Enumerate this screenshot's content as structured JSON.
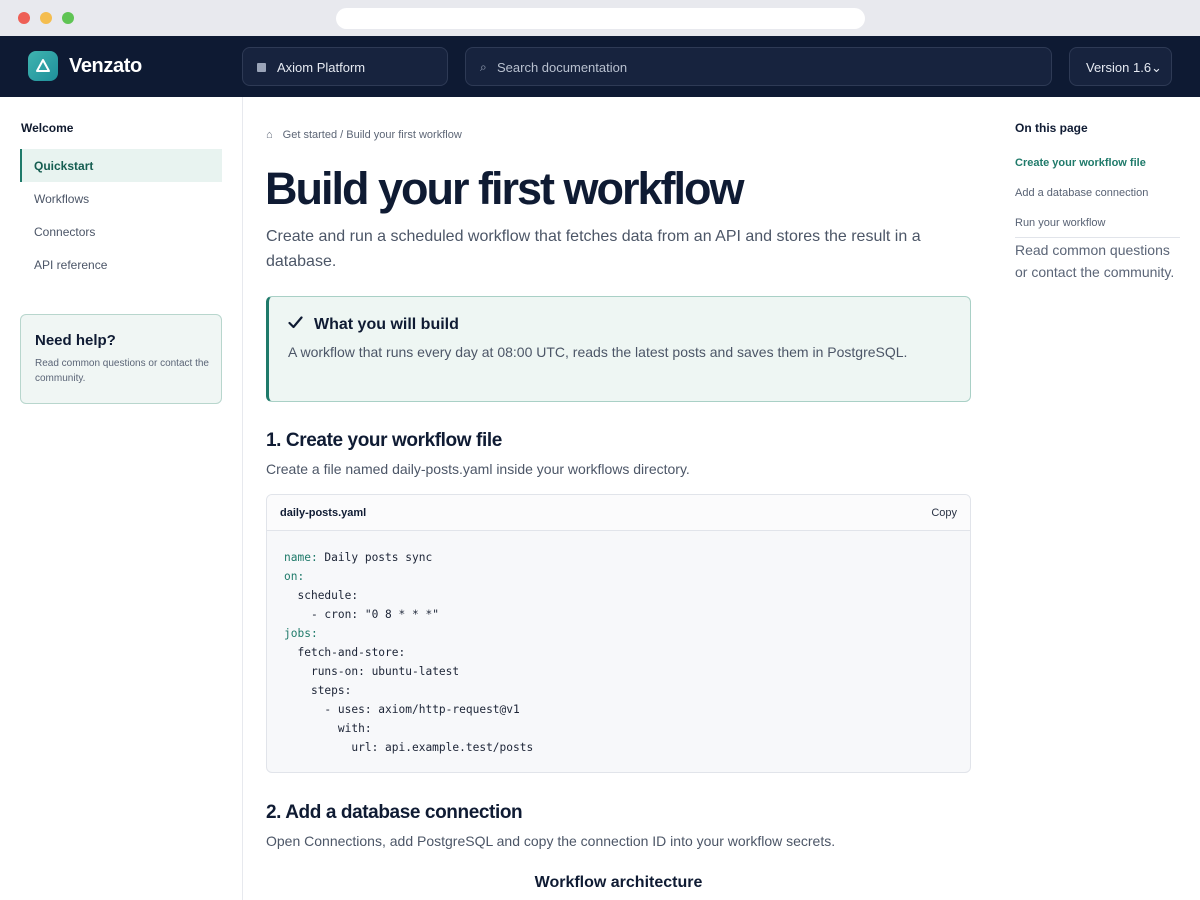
{
  "brand": {
    "name": "Venzato"
  },
  "topnav": {
    "platform": "Axiom Platform",
    "search_placeholder": "Search documentation",
    "version": "Version 1.6",
    "version_chevron": "⌄"
  },
  "sidebar": {
    "heading": "Welcome",
    "items": [
      {
        "label": "Quickstart",
        "active": true
      },
      {
        "label": "Workflows",
        "active": false
      },
      {
        "label": "Connectors",
        "active": false
      },
      {
        "label": "API reference",
        "active": false
      }
    ],
    "help": {
      "title": "Need help?",
      "text": "Read common questions or contact the community."
    }
  },
  "main": {
    "breadcrumb": "Get started / Build your first workflow",
    "title": "Build your first workflow",
    "lead": "Create and run a scheduled workflow that fetches data from an API and stores the result in a database.",
    "callout": {
      "title": "What you will build",
      "text": "A workflow that runs every day at 08:00 UTC, reads the latest posts and saves them in PostgreSQL."
    },
    "section1": {
      "title": "1. Create your workflow file",
      "text": "Create a file named daily-posts.yaml inside your workflows directory."
    },
    "code": {
      "filename": "daily-posts.yaml",
      "copy_label": "Copy",
      "lines": [
        {
          "key": "name:",
          "value": " Daily posts sync",
          "indent": ""
        },
        {
          "key": "on:",
          "value": "",
          "indent": ""
        },
        {
          "key": "",
          "value": "schedule:",
          "indent": "  "
        },
        {
          "key": "",
          "value": "- cron: \"0 8 * * *\"",
          "indent": "    "
        },
        {
          "key": "jobs:",
          "value": "",
          "indent": ""
        },
        {
          "key": "",
          "value": "fetch-and-store:",
          "indent": "  "
        },
        {
          "key": "",
          "value": "runs-on: ubuntu-latest",
          "indent": "    "
        },
        {
          "key": "",
          "value": "steps:",
          "indent": "    "
        },
        {
          "key": "",
          "value": "- uses: axiom/http-request@v1",
          "indent": "      "
        },
        {
          "key": "",
          "value": "with:",
          "indent": "        "
        },
        {
          "key": "",
          "value": "url: api.example.test/posts",
          "indent": "          "
        }
      ]
    },
    "section2": {
      "title": "2. Add a database connection",
      "text": "Open Connections, add PostgreSQL and copy the connection ID into your workflow secrets."
    },
    "diagram_title": "Workflow architecture"
  },
  "toc": {
    "heading": "On this page",
    "items": [
      {
        "label": "Create your workflow file",
        "active": true
      },
      {
        "label": "Add a database connection",
        "active": false
      },
      {
        "label": "Run your workflow",
        "active": false
      }
    ],
    "note": "Read common questions or contact the community."
  }
}
